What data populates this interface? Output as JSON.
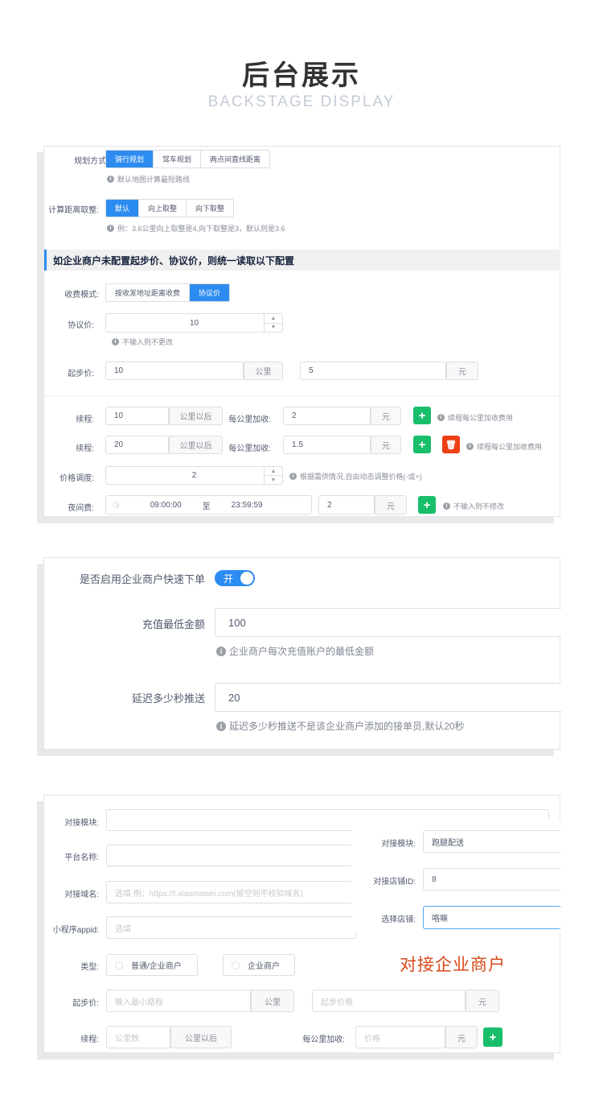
{
  "hero": {
    "title": "后台展示",
    "subtitle": "BACKSTAGE DISPLAY"
  },
  "panel1": {
    "plan_label": "规划方式:",
    "plan_options": [
      "骑行规划",
      "驾车规划",
      "两点间直线距离"
    ],
    "plan_hint": "默认地图计算最短路线",
    "round_label": "计算距离取整:",
    "round_options": [
      "默认",
      "向上取整",
      "向下取整"
    ],
    "round_hint": "例：3.6公里向上取整是4,向下取整是3，默认则是3.6",
    "section_title": "如企业商户未配置起步价、协议价，则统一读取以下配置",
    "fee_mode_label": "收费模式:",
    "fee_mode_options": [
      "按收发地址距离收费",
      "协议价"
    ],
    "agreed_label": "协议价:",
    "agreed_value": "10",
    "agreed_hint": "不输入则不更改",
    "start_label": "起步价:",
    "start_km": "10",
    "unit_km": "公里",
    "start_price": "5",
    "unit_yuan": "元",
    "continue_label": "续程:",
    "km_after": "公里以后",
    "per_km_label": "每公里加收:",
    "row1_km": "10",
    "row1_price": "2",
    "row1_hint": "续程每公里加收费用",
    "row2_km": "20",
    "row2_price": "1.5",
    "row2_hint": "续程每公里加收费用",
    "adjust_label": "价格调度:",
    "adjust_value": "2",
    "adjust_hint": "根据需供情况,自由动态调整价格(-或+)",
    "night_label": "夜间费:",
    "night_start": "09:00:00",
    "night_to": "至",
    "night_end": "23:59:59",
    "night_price": "2",
    "night_hint": "不输入则不修改"
  },
  "panel2": {
    "quick_label": "是否启用企业商户快速下单",
    "toggle_text": "开",
    "min_label": "充值最低金额",
    "min_value": "100",
    "min_hint": "企业商户每次充值账户的最低金额",
    "delay_label": "延迟多少秒推送",
    "delay_value": "20",
    "delay_hint": "延迟多少秒推送不是该企业商户添加的接单员,默认20秒"
  },
  "panel3": {
    "module_label": "对接模块:",
    "platform_label": "平台名称:",
    "domain_label": "对接域名:",
    "domain_placeholder": "选填 例：https://t.xiaomawei.com(留空则不校验域名)",
    "appid_label": "小程序appid:",
    "appid_placeholder": "选填",
    "right_module_label": "对接模块:",
    "right_module_value": "跑腿配送",
    "shop_id_label": "对接店铺ID:",
    "shop_id_value": "8",
    "shop_label": "选择店铺:",
    "shop_value": "咯嘛",
    "type_label": "类型:",
    "type_options": [
      "普通/企业商户",
      "企业商户"
    ],
    "banner": "对接企业商户",
    "start_label": "起步价:",
    "min_distance_placeholder": "输入最小路程",
    "unit_km": "公里",
    "start_price_placeholder": "起步价格",
    "unit_yuan": "元",
    "continue_label": "续程:",
    "km_count_placeholder": "公里数",
    "km_after": "公里以后",
    "per_km_label": "每公里加收:",
    "price_placeholder": "价格"
  }
}
